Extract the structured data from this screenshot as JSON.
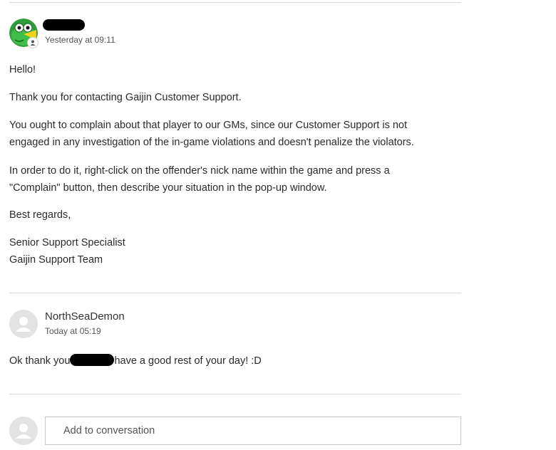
{
  "message1": {
    "timestamp": "Yesterday at 09:11",
    "greeting": "Hello!",
    "thanks": "Thank you for contacting Gaijin Customer Support.",
    "paragraph1_line1": "You ought to complain about that player to our GMs, since our Customer Support is not",
    "paragraph1_line2": "engaged in any investigation of the in-game violations and doesn't penalize the violators.",
    "paragraph2_line1": "In order to do it, right-click on the offender's nick name within the game and press a",
    "paragraph2_line2": "\"Complain\" button, then describe your situation in the pop-up window.",
    "closing": "Best regards,",
    "signature_line1": "Senior Support Specialist",
    "signature_line2": "Gaijin Support Team"
  },
  "message2": {
    "author": "NorthSeaDemon",
    "timestamp": "Today at 05:19",
    "text_before": "Ok thank you",
    "text_after": "have a good rest of your day! :D"
  },
  "composer": {
    "placeholder": "Add to conversation"
  }
}
